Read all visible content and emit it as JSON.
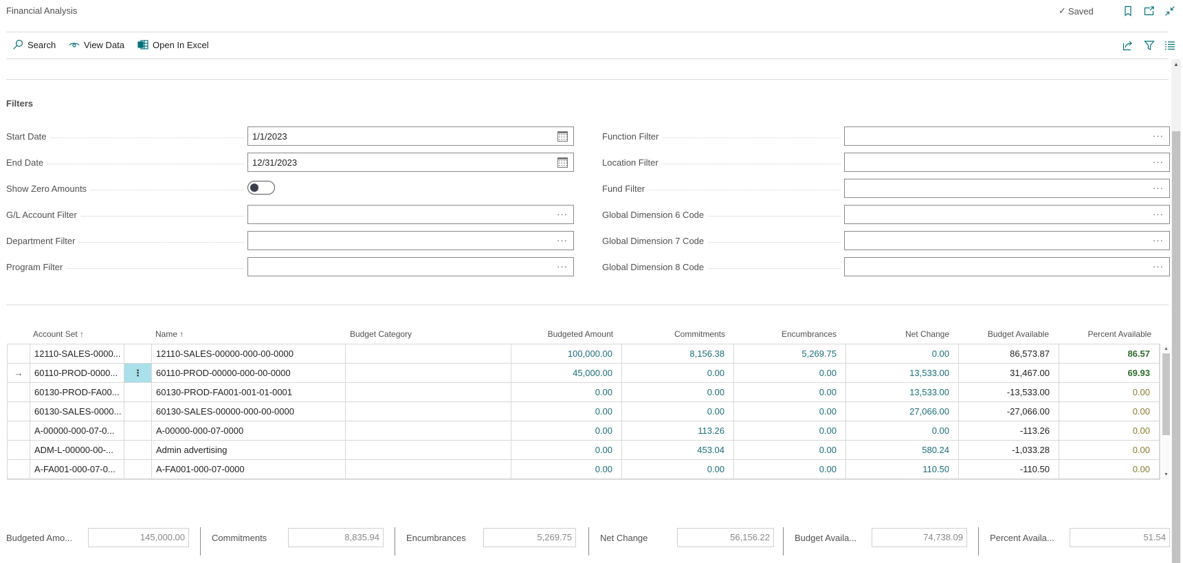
{
  "header": {
    "title": "Financial Analysis",
    "status": "Saved",
    "icons": [
      "bookmark-icon",
      "open-new-window-icon",
      "collapse-icon"
    ]
  },
  "toolbar": {
    "actions": [
      {
        "label": "Search",
        "icon": "search-icon"
      },
      {
        "label": "View Data",
        "icon": "eye-icon"
      },
      {
        "label": "Open In Excel",
        "icon": "excel-icon"
      }
    ],
    "right_icons": [
      "share-icon",
      "filter-icon",
      "list-view-icon"
    ]
  },
  "filters": {
    "title": "Filters",
    "left": [
      {
        "label": "Start Date",
        "value": "1/1/2023",
        "type": "date"
      },
      {
        "label": "End Date",
        "value": "12/31/2023",
        "type": "date"
      },
      {
        "label": "Show Zero Amounts",
        "value": false,
        "type": "toggle"
      },
      {
        "label": "G/L Account Filter",
        "value": "",
        "type": "lookup"
      },
      {
        "label": "Department Filter",
        "value": "",
        "type": "lookup"
      },
      {
        "label": "Program Filter",
        "value": "",
        "type": "lookup"
      }
    ],
    "right": [
      {
        "label": "Function Filter",
        "value": "",
        "type": "lookup"
      },
      {
        "label": "Location Filter",
        "value": "",
        "type": "lookup"
      },
      {
        "label": "Fund Filter",
        "value": "",
        "type": "lookup"
      },
      {
        "label": "Global Dimension 6 Code",
        "value": "",
        "type": "lookup"
      },
      {
        "label": "Global Dimension 7 Code",
        "value": "",
        "type": "lookup"
      },
      {
        "label": "Global Dimension 8 Code",
        "value": "",
        "type": "lookup"
      }
    ],
    "lookup_glyph": "···"
  },
  "table": {
    "columns": {
      "account_set": "Account Set ↑",
      "name": "Name ↑",
      "budget_category": "Budget Category",
      "budgeted_amount": "Budgeted Amount",
      "commitments": "Commitments",
      "encumbrances": "Encumbrances",
      "net_change": "Net Change",
      "budget_available": "Budget Available",
      "percent_available": "Percent Available"
    },
    "current_row_indicator": "→",
    "row_menu_glyph": "⋮",
    "rows": [
      {
        "account_set": "12110-SALES-0000...",
        "name": "12110-SALES-00000-000-00-0000",
        "budget_category": "",
        "budgeted_amount": "100,000.00",
        "commitments": "8,156.38",
        "encumbrances": "5,269.75",
        "net_change": "0.00",
        "budget_available": "86,573.87",
        "percent_available": "86.57",
        "current": false
      },
      {
        "account_set": "60110-PROD-0000...",
        "name": "60110-PROD-00000-000-00-0000",
        "budget_category": "",
        "budgeted_amount": "45,000.00",
        "commitments": "0.00",
        "encumbrances": "0.00",
        "net_change": "13,533.00",
        "budget_available": "31,467.00",
        "percent_available": "69.93",
        "current": true
      },
      {
        "account_set": "60130-PROD-FA00...",
        "name": "60130-PROD-FA001-001-01-0001",
        "budget_category": "",
        "budgeted_amount": "0.00",
        "commitments": "0.00",
        "encumbrances": "0.00",
        "net_change": "13,533.00",
        "budget_available": "-13,533.00",
        "percent_available": "0.00",
        "current": false
      },
      {
        "account_set": "60130-SALES-0000...",
        "name": "60130-SALES-00000-000-00-0000",
        "budget_category": "",
        "budgeted_amount": "0.00",
        "commitments": "0.00",
        "encumbrances": "0.00",
        "net_change": "27,066.00",
        "budget_available": "-27,066.00",
        "percent_available": "0.00",
        "current": false
      },
      {
        "account_set": "A-00000-000-07-0...",
        "name": "A-00000-000-07-0000",
        "budget_category": "",
        "budgeted_amount": "0.00",
        "commitments": "113.26",
        "encumbrances": "0.00",
        "net_change": "0.00",
        "budget_available": "-113.26",
        "percent_available": "0.00",
        "current": false
      },
      {
        "account_set": "ADM-L-00000-00-...",
        "name": "Admin advertising",
        "budget_category": "",
        "budgeted_amount": "0.00",
        "commitments": "453.04",
        "encumbrances": "0.00",
        "net_change": "580.24",
        "budget_available": "-1,033.28",
        "percent_available": "0.00",
        "current": false
      },
      {
        "account_set": "A-FA001-000-07-0...",
        "name": "A-FA001-000-07-0000",
        "budget_category": "",
        "budgeted_amount": "0.00",
        "commitments": "0.00",
        "encumbrances": "0.00",
        "net_change": "110.50",
        "budget_available": "-110.50",
        "percent_available": "0.00",
        "current": false
      }
    ]
  },
  "totals": [
    {
      "label": "Budgeted Amo...",
      "value": "145,000.00"
    },
    {
      "label": "Commitments",
      "value": "8,835.94"
    },
    {
      "label": "Encumbrances",
      "value": "5,269.75"
    },
    {
      "label": "Net Change",
      "value": "56,156.22"
    },
    {
      "label": "Budget Availa...",
      "value": "74,738.09"
    },
    {
      "label": "Percent Availa...",
      "value": "51.54"
    }
  ],
  "colors": {
    "accent": "#00707a",
    "amount_link": "#1a6e7a",
    "percent_high": "#2e6b2e",
    "percent_zero": "#8a7a2e",
    "selected_cell": "#a9e0e9"
  }
}
